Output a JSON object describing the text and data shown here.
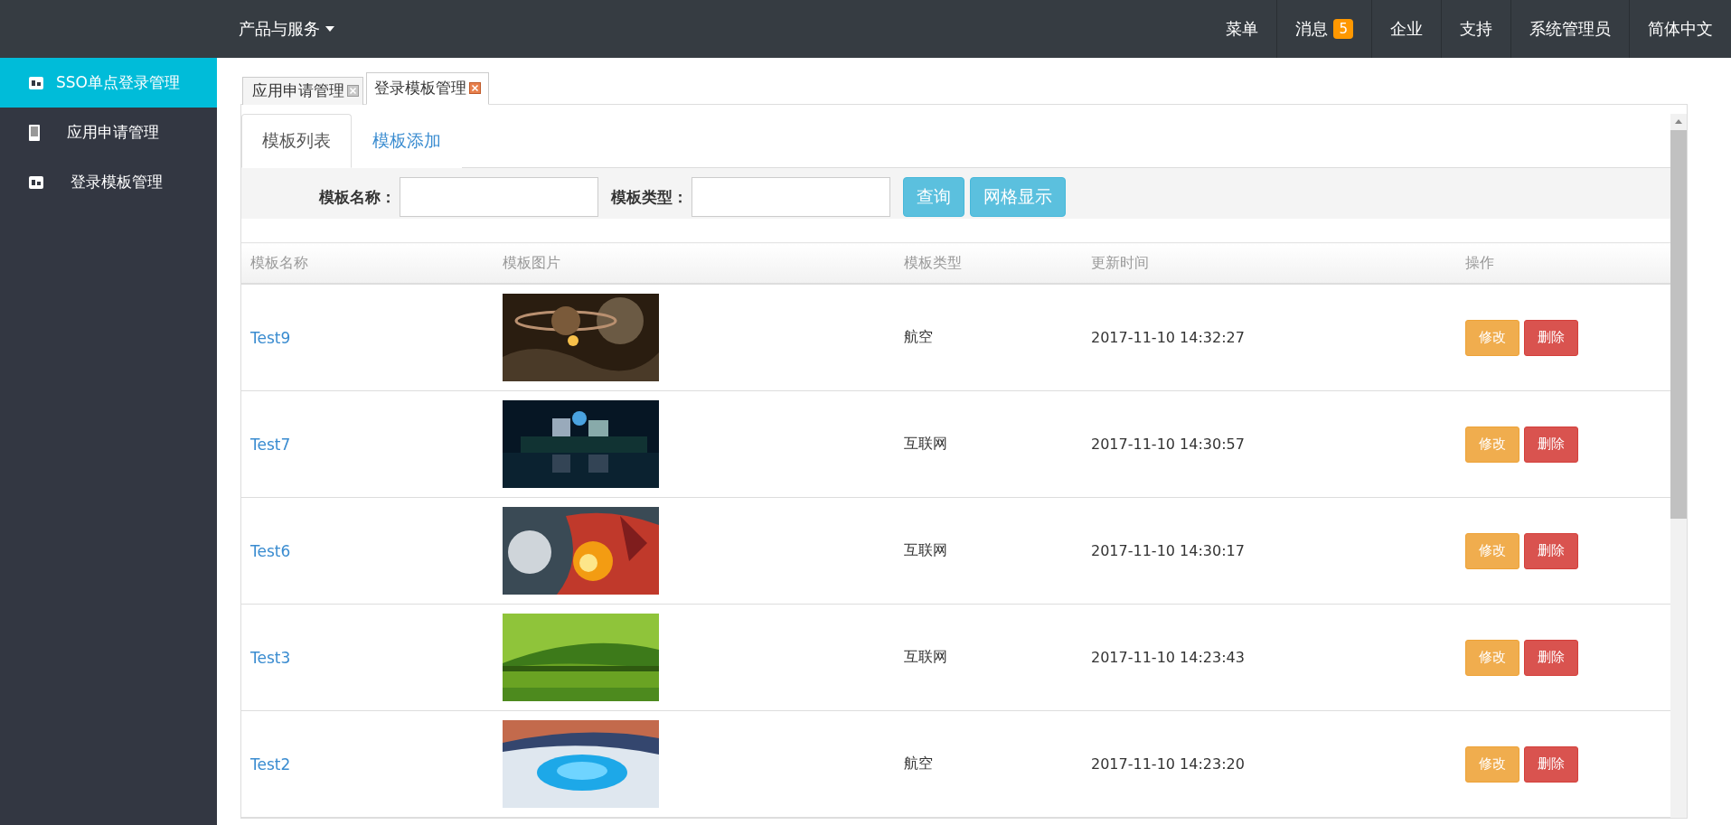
{
  "topbar": {
    "product_menu": "产品与服务",
    "items": [
      {
        "label": "菜单"
      },
      {
        "label": "消息",
        "badge": "5"
      },
      {
        "label": "企业"
      },
      {
        "label": "支持"
      },
      {
        "label": "系统管理员"
      },
      {
        "label": "简体中文"
      }
    ]
  },
  "sidebar": {
    "items": [
      {
        "label": "SSO单点登录管理",
        "selected": true,
        "kind": "be"
      },
      {
        "label": "应用申请管理",
        "selected": false,
        "kind": "phone"
      },
      {
        "label": "登录模板管理",
        "selected": false,
        "kind": "be"
      }
    ]
  },
  "page_tabs": [
    {
      "label": "应用申请管理",
      "selected": false
    },
    {
      "label": "登录模板管理",
      "selected": true
    }
  ],
  "inner_tabs": [
    {
      "label": "模板列表",
      "selected": true
    },
    {
      "label": "模板添加",
      "selected": false
    }
  ],
  "search": {
    "fields": [
      {
        "label": "模板名称："
      },
      {
        "label": "模板类型："
      }
    ],
    "buttons": [
      "查询",
      "网格显示"
    ]
  },
  "table": {
    "columns": [
      "模板名称",
      "模板图片",
      "模板类型",
      "更新时间",
      "操作"
    ],
    "rows": [
      {
        "name": "Test9",
        "image": {
          "kind": "picture"
        },
        "type": "航空",
        "updated": "2017-11-10 14:32:27",
        "actions": [
          "修改",
          "删除"
        ]
      },
      {
        "name": "Test7",
        "image": {
          "kind": "picture"
        },
        "type": "互联网",
        "updated": "2017-11-10 14:30:57",
        "actions": [
          "修改",
          "删除"
        ]
      },
      {
        "name": "Test6",
        "image": {
          "kind": "picture"
        },
        "type": "互联网",
        "updated": "2017-11-10 14:30:17",
        "actions": [
          "修改",
          "删除"
        ]
      },
      {
        "name": "Test3",
        "image": {
          "kind": "picture"
        },
        "type": "互联网",
        "updated": "2017-11-10 14:23:43",
        "actions": [
          "修改",
          "删除"
        ]
      },
      {
        "name": "Test2",
        "image": {
          "kind": "picture"
        },
        "type": "航空",
        "updated": "2017-11-10 14:23:20",
        "actions": [
          "修改",
          "删除"
        ]
      }
    ]
  }
}
